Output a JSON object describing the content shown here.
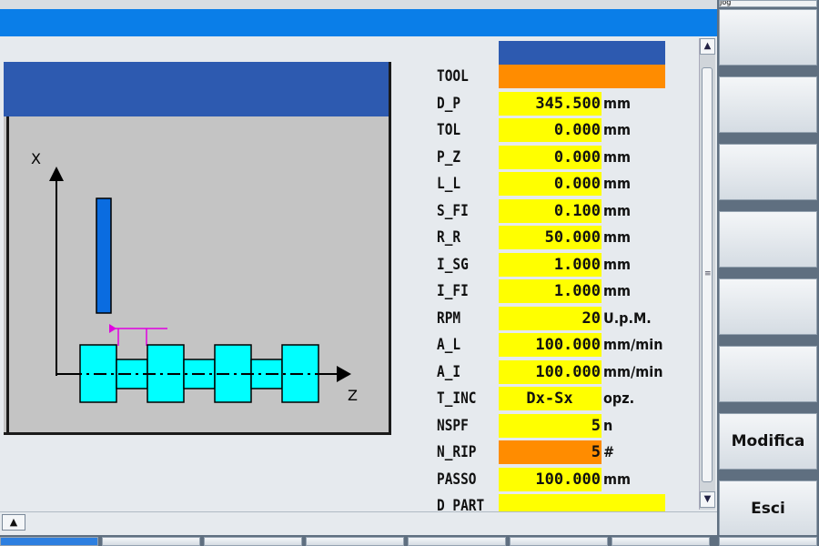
{
  "graphic": {
    "axis_x_label": "X",
    "axis_z_label": "Z"
  },
  "params": [
    {
      "label": "TOOL",
      "value": "",
      "unit": "",
      "style": "orange-wide"
    },
    {
      "label": "D_P",
      "value": "345.500",
      "unit": "mm"
    },
    {
      "label": "TOL",
      "value": "0.000",
      "unit": "mm"
    },
    {
      "label": "P_Z",
      "value": "0.000",
      "unit": "mm"
    },
    {
      "label": "L_L",
      "value": "0.000",
      "unit": "mm"
    },
    {
      "label": "S_FI",
      "value": "0.100",
      "unit": "mm"
    },
    {
      "label": "R_R",
      "value": "50.000",
      "unit": "mm"
    },
    {
      "label": "I_SG",
      "value": "1.000",
      "unit": "mm"
    },
    {
      "label": "I_FI",
      "value": "1.000",
      "unit": "mm"
    },
    {
      "label": "RPM",
      "value": "20",
      "unit": "U.p.M."
    },
    {
      "label": "A_L",
      "value": "100.000",
      "unit": "mm/min"
    },
    {
      "label": "A_I",
      "value": "100.000",
      "unit": "mm/min"
    },
    {
      "label": "T_INC",
      "value": "Dx-Sx",
      "unit": "opz."
    },
    {
      "label": "NSPF",
      "value": "5",
      "unit": "n"
    },
    {
      "label": "N_RIP",
      "value": "5",
      "unit": "#",
      "style": "orange"
    },
    {
      "label": "PASSO",
      "value": "100.000",
      "unit": "mm"
    },
    {
      "label": "D_PART",
      "value": "",
      "unit": "",
      "style": "wide"
    }
  ],
  "softkeys": {
    "top_label": "Jog",
    "modifica": "Modifica",
    "esci": "Esci"
  },
  "scroll": {
    "up": "▲",
    "down": "▼"
  },
  "colors": {
    "field": "#ffff00",
    "field_active": "#ff8c00",
    "header_blue": "#2d5ab0",
    "title_blue": "#0a7ee8",
    "part_cyan": "#00ffff"
  }
}
